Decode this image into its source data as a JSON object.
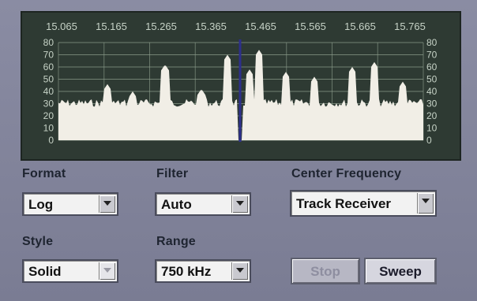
{
  "spectrum": {
    "freq_labels": [
      "15.065",
      "15.165",
      "15.265",
      "15.365",
      "15.465",
      "15.565",
      "15.665",
      "15.765"
    ],
    "db_labels": [
      "80",
      "70",
      "60",
      "50",
      "40",
      "30",
      "20",
      "10",
      "0"
    ],
    "colors": {
      "background": "#2e3a33",
      "grid": "#8fa08f",
      "fill": "#f1eee6",
      "marker": "#2d2f8c",
      "label": "#c6d2c6"
    }
  },
  "controls": {
    "format": {
      "label": "Format",
      "value": "Log"
    },
    "filter": {
      "label": "Filter",
      "value": "Auto"
    },
    "center_frequency": {
      "label": "Center Frequency",
      "value": "Track Receiver"
    },
    "style": {
      "label": "Style",
      "value": "Solid"
    },
    "range": {
      "label": "Range",
      "value": "750 kHz"
    }
  },
  "buttons": {
    "stop": "Stop",
    "sweep": "Sweep"
  }
}
